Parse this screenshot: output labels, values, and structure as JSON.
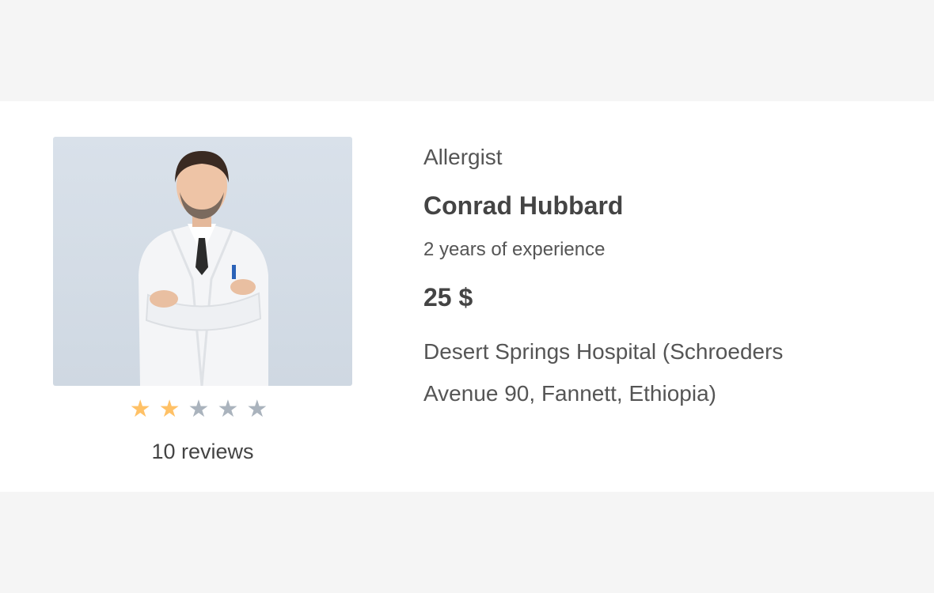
{
  "doctor": {
    "specialty": "Allergist",
    "name": "Conrad Hubbard",
    "experience": "2 years of experience",
    "price": "25 $",
    "address": "Desert Springs Hospital (Schroeders Avenue 90, Fannett, Ethiopia)",
    "photo_icon": "doctor-photo"
  },
  "rating": {
    "value": 2,
    "max": 5,
    "star_char": "★",
    "filled_color": "#ffc166",
    "empty_color": "#aab3bd"
  },
  "reviews": {
    "label": "10 reviews"
  }
}
